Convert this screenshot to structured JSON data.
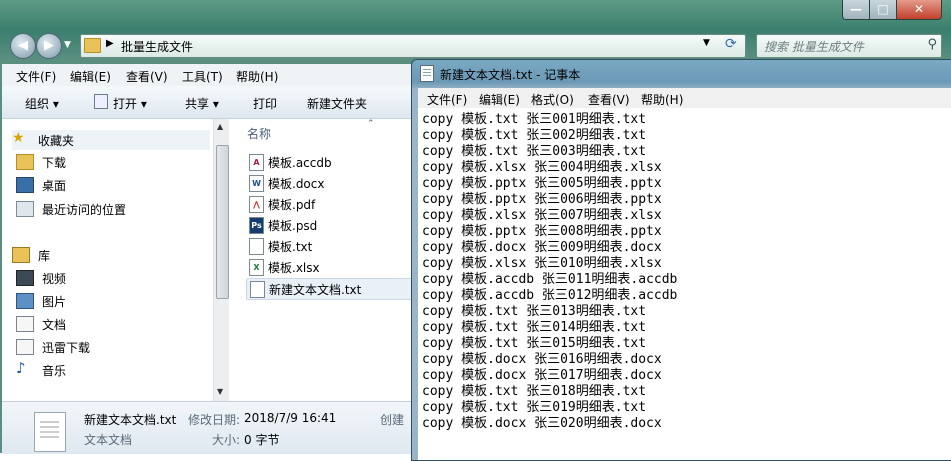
{
  "explorer": {
    "window_controls": {
      "minimize": "—",
      "maximize": "□",
      "close": "✕"
    },
    "address": {
      "path": "批量生成文件"
    },
    "search": {
      "placeholder": "搜索 批量生成文件"
    },
    "menu": [
      "文件(F)",
      "编辑(E)",
      "查看(V)",
      "工具(T)",
      "帮助(H)"
    ],
    "toolbar": {
      "organize": "组织 ▾",
      "open": "打开 ▾",
      "share": "共享 ▾",
      "print": "打印",
      "new_folder": "新建文件夹"
    },
    "nav": {
      "favorites": "收藏夹",
      "downloads": "下载",
      "desktop": "桌面",
      "recent": "最近访问的位置",
      "libraries": "库",
      "videos": "视频",
      "pictures": "图片",
      "documents": "文档",
      "thunder": "迅雷下载",
      "music": "音乐"
    },
    "filelist": {
      "header": "名称",
      "items": [
        {
          "name": "模板.accdb",
          "icon": "A"
        },
        {
          "name": "模板.docx",
          "icon": "W"
        },
        {
          "name": "模板.pdf",
          "icon": "⋀"
        },
        {
          "name": "模板.psd",
          "icon": "Ps"
        },
        {
          "name": "模板.txt",
          "icon": ""
        },
        {
          "name": "模板.xlsx",
          "icon": "X"
        },
        {
          "name": "新建文本文档.txt",
          "icon": ""
        }
      ]
    },
    "details": {
      "filename": "新建文本文档.txt",
      "modified_label": "修改日期:",
      "modified_value": "2018/7/9 16:41",
      "type": "文本文档",
      "size_label": "大小:",
      "size_value": "0 字节",
      "created_label": "创建"
    }
  },
  "notepad": {
    "title": "新建文本文档.txt - 记事本",
    "menu": [
      "文件(F)",
      "编辑(E)",
      "格式(O)",
      "查看(V)",
      "帮助(H)"
    ],
    "lines": [
      "copy 模板.txt 张三001明细表.txt",
      "copy 模板.txt 张三002明细表.txt",
      "copy 模板.txt 张三003明细表.txt",
      "copy 模板.xlsx 张三004明细表.xlsx",
      "copy 模板.pptx 张三005明细表.pptx",
      "copy 模板.pptx 张三006明细表.pptx",
      "copy 模板.xlsx 张三007明细表.xlsx",
      "copy 模板.pptx 张三008明细表.pptx",
      "copy 模板.docx 张三009明细表.docx",
      "copy 模板.xlsx 张三010明细表.xlsx",
      "copy 模板.accdb 张三011明细表.accdb",
      "copy 模板.accdb 张三012明细表.accdb",
      "copy 模板.txt 张三013明细表.txt",
      "copy 模板.txt 张三014明细表.txt",
      "copy 模板.txt 张三015明细表.txt",
      "copy 模板.docx 张三016明细表.docx",
      "copy 模板.docx 张三017明细表.docx",
      "copy 模板.txt 张三018明细表.txt",
      "copy 模板.txt 张三019明细表.txt",
      "copy 模板.docx 张三020明细表.docx"
    ]
  }
}
